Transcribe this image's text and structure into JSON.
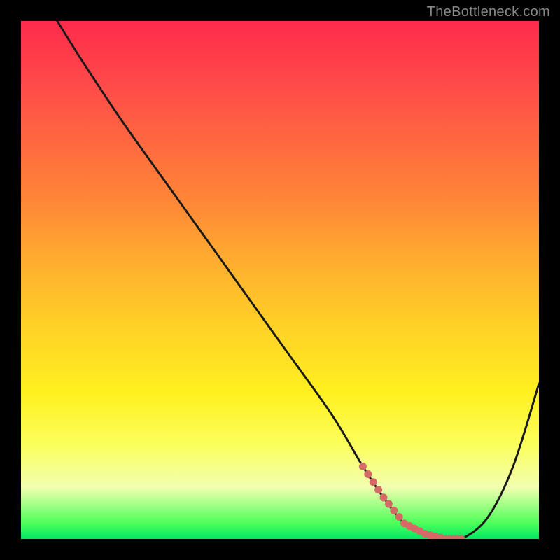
{
  "watermark": "TheBottleneck.com",
  "chart_data": {
    "type": "line",
    "title": "",
    "xlabel": "",
    "ylabel": "",
    "xlim": [
      0,
      100
    ],
    "ylim": [
      0,
      100
    ],
    "series": [
      {
        "name": "curve",
        "x": [
          7,
          12,
          20,
          30,
          40,
          50,
          60,
          66,
          70,
          74,
          78,
          82,
          85,
          90,
          95,
          100
        ],
        "values": [
          100,
          92,
          80,
          66,
          52,
          38,
          24,
          14,
          8,
          3,
          1,
          0,
          0,
          4,
          14,
          30
        ]
      }
    ],
    "flat_region": {
      "x": [
        66,
        70,
        74,
        78,
        82,
        85
      ],
      "values": [
        14,
        8,
        3,
        1,
        0,
        0
      ]
    },
    "colors": {
      "curve": "#1a1a1a",
      "dots": "#d36a66",
      "gradient_top": "#ff2a4b",
      "gradient_bottom": "#00e865"
    }
  }
}
